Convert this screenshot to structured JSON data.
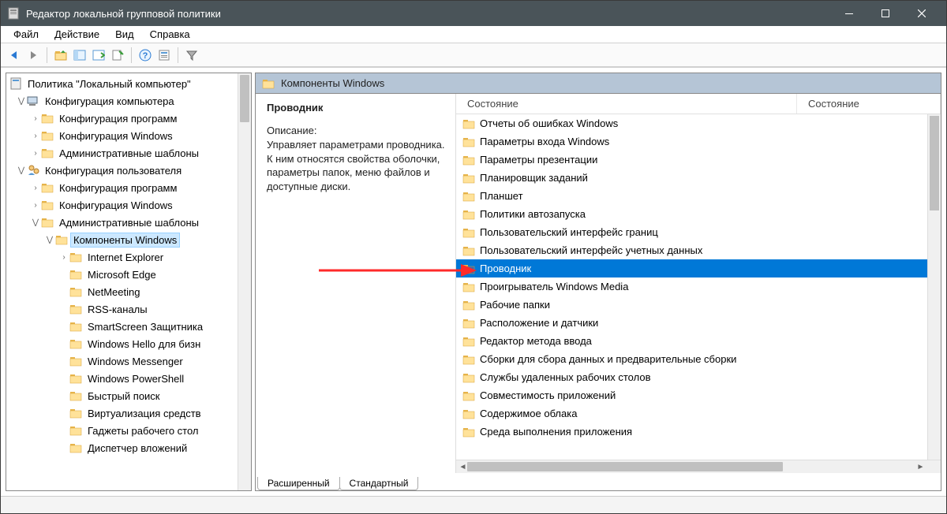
{
  "titlebar": {
    "title": "Редактор локальной групповой политики"
  },
  "menubar": [
    "Файл",
    "Действие",
    "Вид",
    "Справка"
  ],
  "tree": {
    "root": "Политика \"Локальный компьютер\"",
    "cc": {
      "label": "Конфигурация компьютера",
      "children": [
        "Конфигурация программ",
        "Конфигурация Windows",
        "Административные шаблоны"
      ]
    },
    "uc": {
      "label": "Конфигурация пользователя",
      "children": {
        "p0": "Конфигурация программ",
        "p1": "Конфигурация Windows",
        "admin": {
          "label": "Административные шаблоны",
          "wincomp": {
            "label": "Компоненты Windows",
            "children": [
              "Internet Explorer",
              "Microsoft Edge",
              "NetMeeting",
              "RSS-каналы",
              "SmartScreen Защитника",
              "Windows Hello для бизн",
              "Windows Messenger",
              "Windows PowerShell",
              "Быстрый поиск",
              "Виртуализация средств",
              "Гаджеты рабочего стол",
              "Диспетчер вложений"
            ]
          }
        }
      }
    }
  },
  "list": {
    "header": "Компоненты Windows",
    "detail": {
      "selected_name": "Проводник",
      "desc_label": "Описание:",
      "desc_text": "Управляет параметрами проводника. К ним относятся свойства оболочки, параметры папок, меню файлов и доступные диски."
    },
    "columns": {
      "state1": "Состояние",
      "state2": "Состояние"
    },
    "items": [
      "Отчеты об ошибках Windows",
      "Параметры входа Windows",
      "Параметры презентации",
      "Планировщик заданий",
      "Планшет",
      "Политики автозапуска",
      "Пользовательский интерфейс границ",
      "Пользовательский интерфейс учетных данных",
      "Проводник",
      "Проигрыватель Windows Media",
      "Рабочие папки",
      "Расположение и датчики",
      "Редактор метода ввода",
      "Сборки для сбора данных и предварительные сборки",
      "Службы удаленных рабочих столов",
      "Совместимость приложений",
      "Содержимое облака",
      "Среда выполнения приложения"
    ],
    "selected_index": 8
  },
  "tabs": {
    "extended": "Расширенный",
    "standard": "Стандартный"
  }
}
